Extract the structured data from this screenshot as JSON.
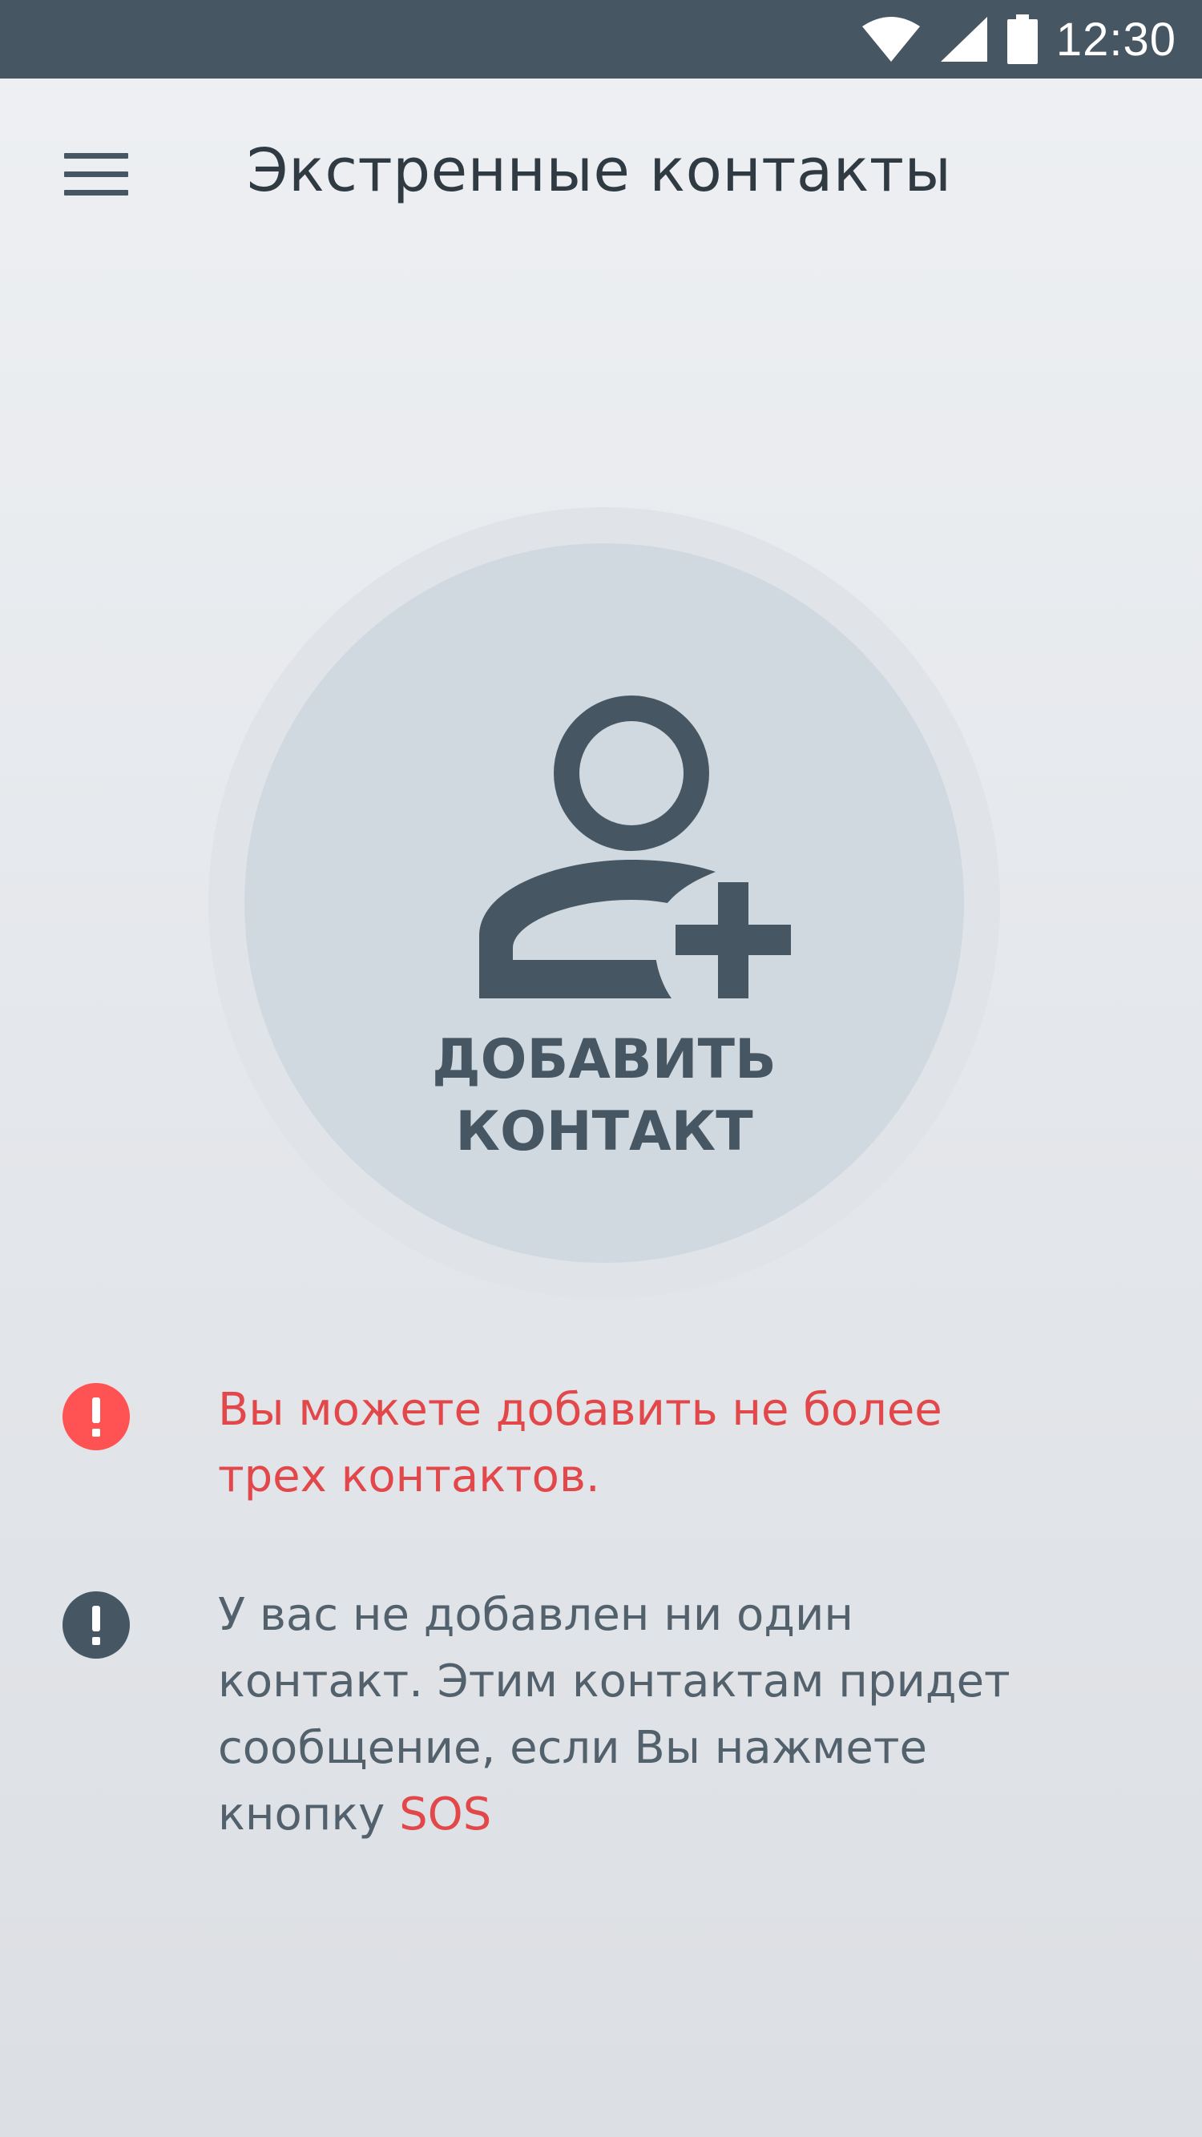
{
  "status_bar": {
    "time": "12:30",
    "background": "#465662",
    "icons": [
      "wifi-icon",
      "cell-signal-icon",
      "battery-icon"
    ]
  },
  "app_bar": {
    "title": "Экстренные контакты",
    "menu_icon": "hamburger-menu-icon"
  },
  "add_contact": {
    "label_line1": "ДОБАВИТЬ",
    "label_line2": "КОНТАКТ",
    "icon": "add-person-icon"
  },
  "notices": {
    "limit": {
      "text_line1": "Вы можете добавить не более",
      "text_line2": "трех контактов.",
      "icon": "alert-icon",
      "color": "#ff5252"
    },
    "empty": {
      "text_line1": "У вас не добавлен ни один",
      "text_line2": "контакт. Этим контактам придет",
      "text_line3": "сообщение, если Вы нажмете",
      "text_line4_prefix": "кнопку ",
      "text_line4_highlight": "SOS",
      "icon": "info-alert-icon",
      "color": "#465662"
    }
  },
  "colors": {
    "primary_dark": "#465662",
    "accent_red": "#e2474a",
    "title_text": "#2f3a43"
  }
}
